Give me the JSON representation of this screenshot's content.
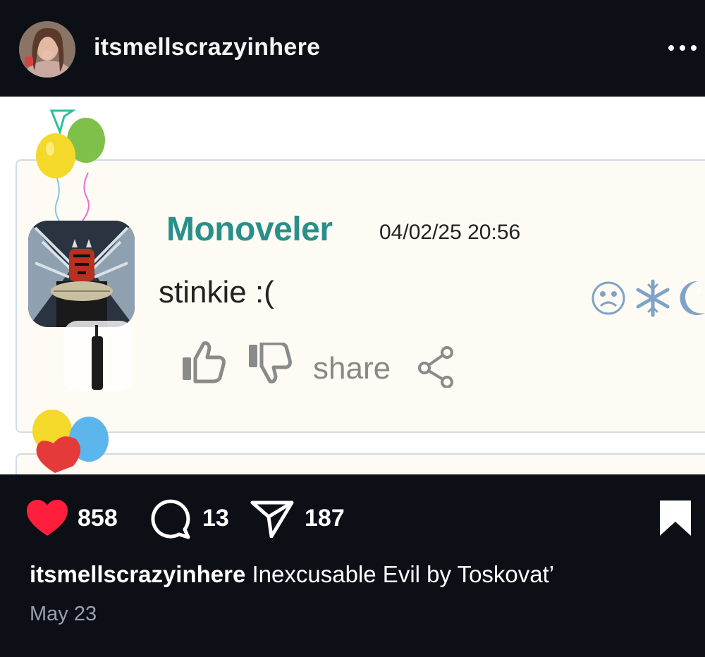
{
  "header": {
    "username": "itsmellscrazyinhere",
    "more_icon": "more-horizontal-icon"
  },
  "post_image": {
    "comment": {
      "author": "Monoveler",
      "timestamp": "04/02/25 20:56",
      "text": "stinkie :(",
      "share_label": "share",
      "status_icons": [
        "sad-face-icon",
        "snowflake-icon",
        "moon-icon"
      ]
    }
  },
  "actions": {
    "likes": "858",
    "comments": "13",
    "shares": "187",
    "like_color": "#ff1f3d"
  },
  "caption": {
    "username": "itsmellscrazyinhere",
    "text": "Inexcusable Evil by Toskovat’"
  },
  "date": "May 23"
}
